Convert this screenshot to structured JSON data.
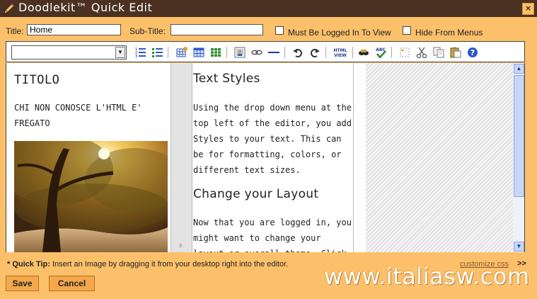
{
  "window": {
    "title": "Doodlekit™ Quick Edit",
    "close_glyph": "×",
    "logo_icon": "pencil-icon"
  },
  "form": {
    "title_label": "Title:",
    "title_value": "Home",
    "subtitle_label": "Sub-Title:",
    "subtitle_value": "",
    "must_login_label": "Must Be Logged In To View",
    "must_login_checked": false,
    "hide_menus_label": "Hide From Menus",
    "hide_menus_checked": false
  },
  "toolbar": {
    "styles_value": "",
    "dropdown_arrow": "▼",
    "icons": [
      "numbered-list-icon",
      "bulleted-list-icon",
      "insert-table-icon",
      "table-properties-icon",
      "table-columns-icon",
      "insert-image-icon",
      "insert-link-icon",
      "horizontal-rule-icon",
      "undo-icon",
      "redo-icon",
      "html-view-icon",
      "find-icon",
      "spellcheck-icon",
      "select-all-icon",
      "cut-icon",
      "copy-icon",
      "paste-icon",
      "help-icon"
    ],
    "html_view_label": "HTML\nVIEW",
    "spell_label": "ABC"
  },
  "content": {
    "left": {
      "heading": "TITOLO",
      "paragraph": "CHI NON CONOSCE L'HTML E' FREGATO"
    },
    "middle": {
      "heading1": "Text Styles",
      "paragraph1": "Using the drop down menu at the top left of the editor, you add Styles to your text. This can be for formatting, colors, or different text sizes.",
      "heading2": "Change your Layout",
      "paragraph2": "Now that you are logged in, you might want to change your layout or overall theme. Click"
    },
    "divider_glyph": "s"
  },
  "footer": {
    "tip_prefix": "* Quick Tip:",
    "tip_text": " Insert an Image by dragging it from your desktop right into the editor.",
    "customize_link": "customize css",
    "customize_arrow": ">>",
    "save_label": "Save",
    "cancel_label": "Cancel"
  },
  "watermark": "www.italiasw.com",
  "colors": {
    "background": "#fcc06a",
    "titlebar": "#4a3121",
    "button": "#f5a84a",
    "link": "#8a5a2b"
  }
}
